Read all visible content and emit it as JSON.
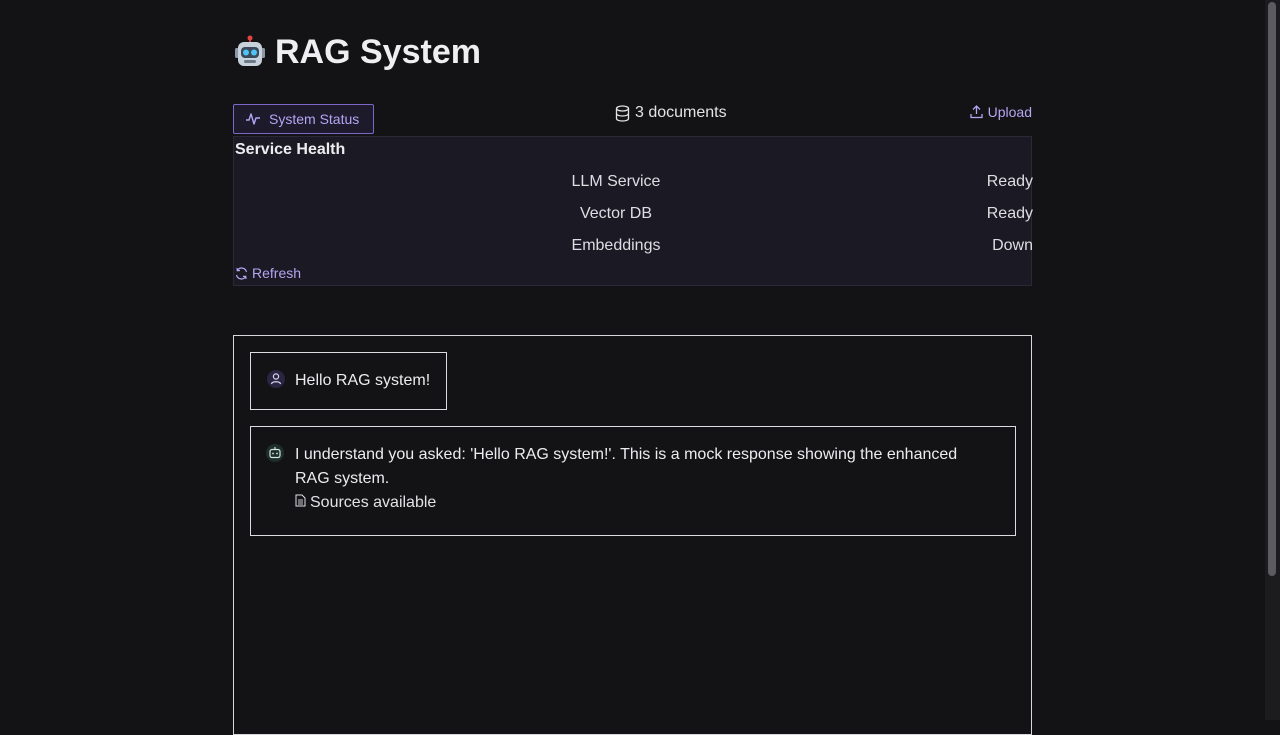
{
  "header": {
    "title": "RAG System",
    "logo_icon": "robot-emoji"
  },
  "toolbar": {
    "status_button": "System Status",
    "doc_count": "3 documents",
    "upload_label": "Upload"
  },
  "health": {
    "title": "Service Health",
    "services": [
      {
        "name": "LLM Service",
        "status": "Ready"
      },
      {
        "name": "Vector DB",
        "status": "Ready"
      },
      {
        "name": "Embeddings",
        "status": "Down"
      }
    ],
    "refresh_label": "Refresh"
  },
  "chat": {
    "user_message": "Hello RAG system!",
    "bot_message": "I understand you asked: 'Hello RAG system!'. This is a mock response showing the enhanced RAG system.",
    "sources_label": "Sources available"
  },
  "colors": {
    "accent": "#b6a5f2",
    "background": "#131316",
    "panel": "#1b1924"
  }
}
